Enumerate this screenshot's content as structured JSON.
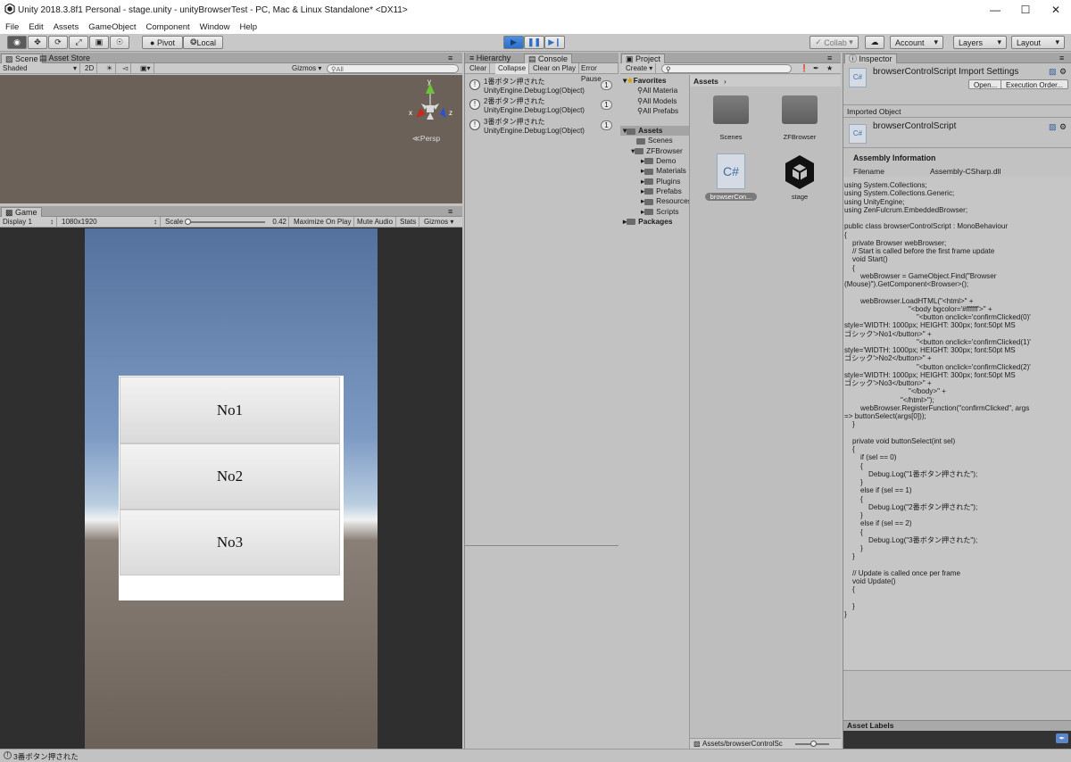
{
  "window": {
    "title": "Unity 2018.3.8f1 Personal - stage.unity - unityBrowserTest - PC, Mac & Linux Standalone* <DX11>"
  },
  "menu": [
    "File",
    "Edit",
    "Assets",
    "GameObject",
    "Component",
    "Window",
    "Help"
  ],
  "toolbar": {
    "pivot": "Pivot",
    "local": "Local",
    "collab": "Collab",
    "account": "Account",
    "layers": "Layers",
    "layout": "Layout"
  },
  "scene": {
    "tab": "Scene",
    "asset_store_tab": "Asset Store",
    "shading": "Shaded",
    "mode_2d": "2D",
    "gizmos": "Gizmos",
    "search_placeholder": "All",
    "persp": "Persp",
    "axis_y": "y",
    "axis_x": "x",
    "axis_z": "z"
  },
  "game": {
    "tab": "Game",
    "display": "Display 1",
    "resolution": "1080x1920",
    "scale_label": "Scale",
    "scale_value": "0.42",
    "maximize": "Maximize On Play",
    "mute": "Mute Audio",
    "stats": "Stats",
    "gizmos": "Gizmos",
    "buttons": [
      "No1",
      "No2",
      "No3"
    ]
  },
  "hierarchy": {
    "tab": "Hierarchy"
  },
  "console": {
    "tab": "Console",
    "clear": "Clear",
    "collapse": "Collapse",
    "clear_on_play": "Clear on Play",
    "error_pause": "Error Pause",
    "entries": [
      {
        "line1": "1番ボタン押された",
        "line2": "UnityEngine.Debug:Log(Object)",
        "count": "1"
      },
      {
        "line1": "2番ボタン押された",
        "line2": "UnityEngine.Debug:Log(Object)",
        "count": "1"
      },
      {
        "line1": "3番ボタン押された",
        "line2": "UnityEngine.Debug:Log(Object)",
        "count": "1"
      }
    ]
  },
  "project": {
    "tab": "Project",
    "create": "Create",
    "favorites": {
      "label": "Favorites",
      "items": [
        "All Materia",
        "All Models",
        "All Prefabs"
      ]
    },
    "assets_tree": {
      "label": "Assets",
      "children": [
        "Scenes",
        "ZFBrowser"
      ],
      "zf_children": [
        "Demo",
        "Materials",
        "Plugins",
        "Prefabs",
        "Resources",
        "Scripts"
      ]
    },
    "packages": "Packages",
    "breadcrumb": "Assets",
    "grid": [
      {
        "name": "Scenes",
        "kind": "folder"
      },
      {
        "name": "ZFBrowser",
        "kind": "folder"
      },
      {
        "name": "browserCon...",
        "kind": "script"
      },
      {
        "name": "stage",
        "kind": "unity"
      }
    ],
    "script_glyph": "C#",
    "status_path": "Assets/browserControlSc"
  },
  "inspector": {
    "tab": "Inspector",
    "import_title": "browserControlScript Import Settings",
    "open": "Open...",
    "exec_order": "Execution Order...",
    "imported_object": "Imported Object",
    "object_name": "browserControlScript",
    "assembly_info": "Assembly Information",
    "filename_label": "Filename",
    "filename_value": "Assembly-CSharp.dll",
    "code": "using System.Collections;\nusing System.Collections.Generic;\nusing UnityEngine;\nusing ZenFulcrum.EmbeddedBrowser;\n\npublic class browserControlScript : MonoBehaviour\n{\n    private Browser webBrowser;\n    // Start is called before the first frame update\n    void Start()\n    {\n        webBrowser = GameObject.Find(\"Browser\n(Mouse)\").GetComponent<Browser>();\n\n        webBrowser.LoadHTML(\"<html>\" +\n                                \"<body bgcolor='#ffffff'>\" +\n                                    \"<button onclick='confirmClicked(0)'\nstyle='WIDTH: 1000px; HEIGHT: 300px; font:50pt MS\nゴシック'>No1</button>\" +\n                                    \"<button onclick='confirmClicked(1)'\nstyle='WIDTH: 1000px; HEIGHT: 300px; font:50pt MS\nゴシック'>No2</button>\" +\n                                    \"<button onclick='confirmClicked(2)'\nstyle='WIDTH: 1000px; HEIGHT: 300px; font:50pt MS\nゴシック'>No3</button>\" +\n                                \"</body>\" +\n                            \"</html>\");\n        webBrowser.RegisterFunction(\"confirmClicked\", args\n=> buttonSelect(args[0]));\n    }\n\n    private void buttonSelect(int sel)\n    {\n        if (sel == 0)\n        {\n            Debug.Log(\"1番ボタン押された\");\n        }\n        else if (sel == 1)\n        {\n            Debug.Log(\"2番ボタン押された\");\n        }\n        else if (sel == 2)\n        {\n            Debug.Log(\"3番ボタン押された\");\n        }\n    }\n\n    // Update is called once per frame\n    void Update()\n    {\n\n    }\n}",
    "asset_labels": "Asset Labels"
  },
  "statusbar": {
    "text": "3番ボタン押された"
  },
  "colors": {
    "accent": "#2c7cd9",
    "scene_bg": "#6b6159",
    "dark_bars": "#2f2f2f"
  }
}
